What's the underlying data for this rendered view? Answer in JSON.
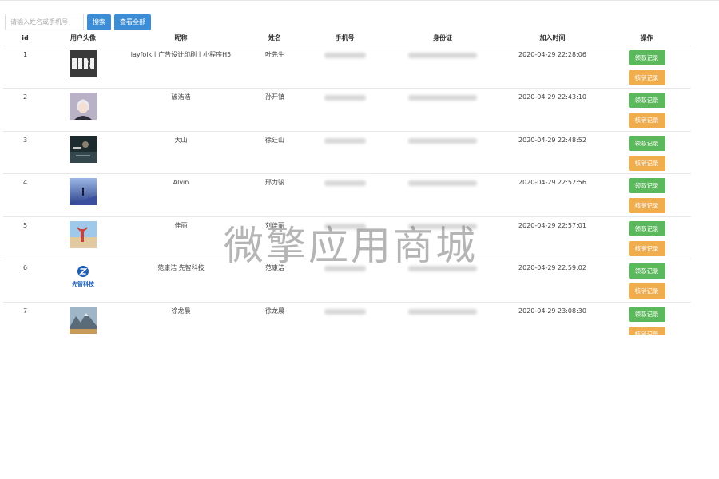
{
  "search": {
    "placeholder": "请输入姓名或手机号",
    "value": ""
  },
  "toolbar": {
    "search_label": "搜索",
    "view_all_label": "查看全部"
  },
  "table": {
    "headers": [
      "id",
      "用户头像",
      "昵称",
      "姓名",
      "手机号",
      "身份证",
      "加入时间",
      "操作"
    ],
    "rows": [
      {
        "id": "1",
        "avatar": "logo-dark",
        "nickname": "layfolk丨广告设计印刷丨小程序H5",
        "name": "叶先生",
        "time": "2020-04-29 22:28:06"
      },
      {
        "id": "2",
        "avatar": "anime-portrait",
        "nickname": "破浩浩",
        "name": "孙开镇",
        "time": "2020-04-29 22:43:10"
      },
      {
        "id": "3",
        "avatar": "night-photo",
        "nickname": "大山",
        "name": "徐廷山",
        "time": "2020-04-29 22:48:52"
      },
      {
        "id": "4",
        "avatar": "blue-figure",
        "nickname": "Alvin",
        "name": "邢力骏",
        "time": "2020-04-29 22:52:56"
      },
      {
        "id": "5",
        "avatar": "beach-person",
        "nickname": "佳丽",
        "name": "刘佳丽",
        "time": "2020-04-29 22:57:01"
      },
      {
        "id": "6",
        "avatar": "company-logo",
        "nickname": "范康洁 先智科技",
        "name": "范康洁",
        "time": "2020-04-29 22:59:02"
      },
      {
        "id": "7",
        "avatar": "mountain-photo",
        "nickname": "徐龙晨",
        "name": "徐龙晨",
        "time": "2020-04-29 23:08:30"
      }
    ],
    "actions": {
      "receive_label": "领取记录",
      "verify_label": "核销记录"
    }
  },
  "avatar_logo_text": "先智科技",
  "watermark": "微擎应用商城",
  "colors": {
    "primary": "#3c8dd6",
    "success": "#5cb85c",
    "warning": "#f0ad4e"
  }
}
